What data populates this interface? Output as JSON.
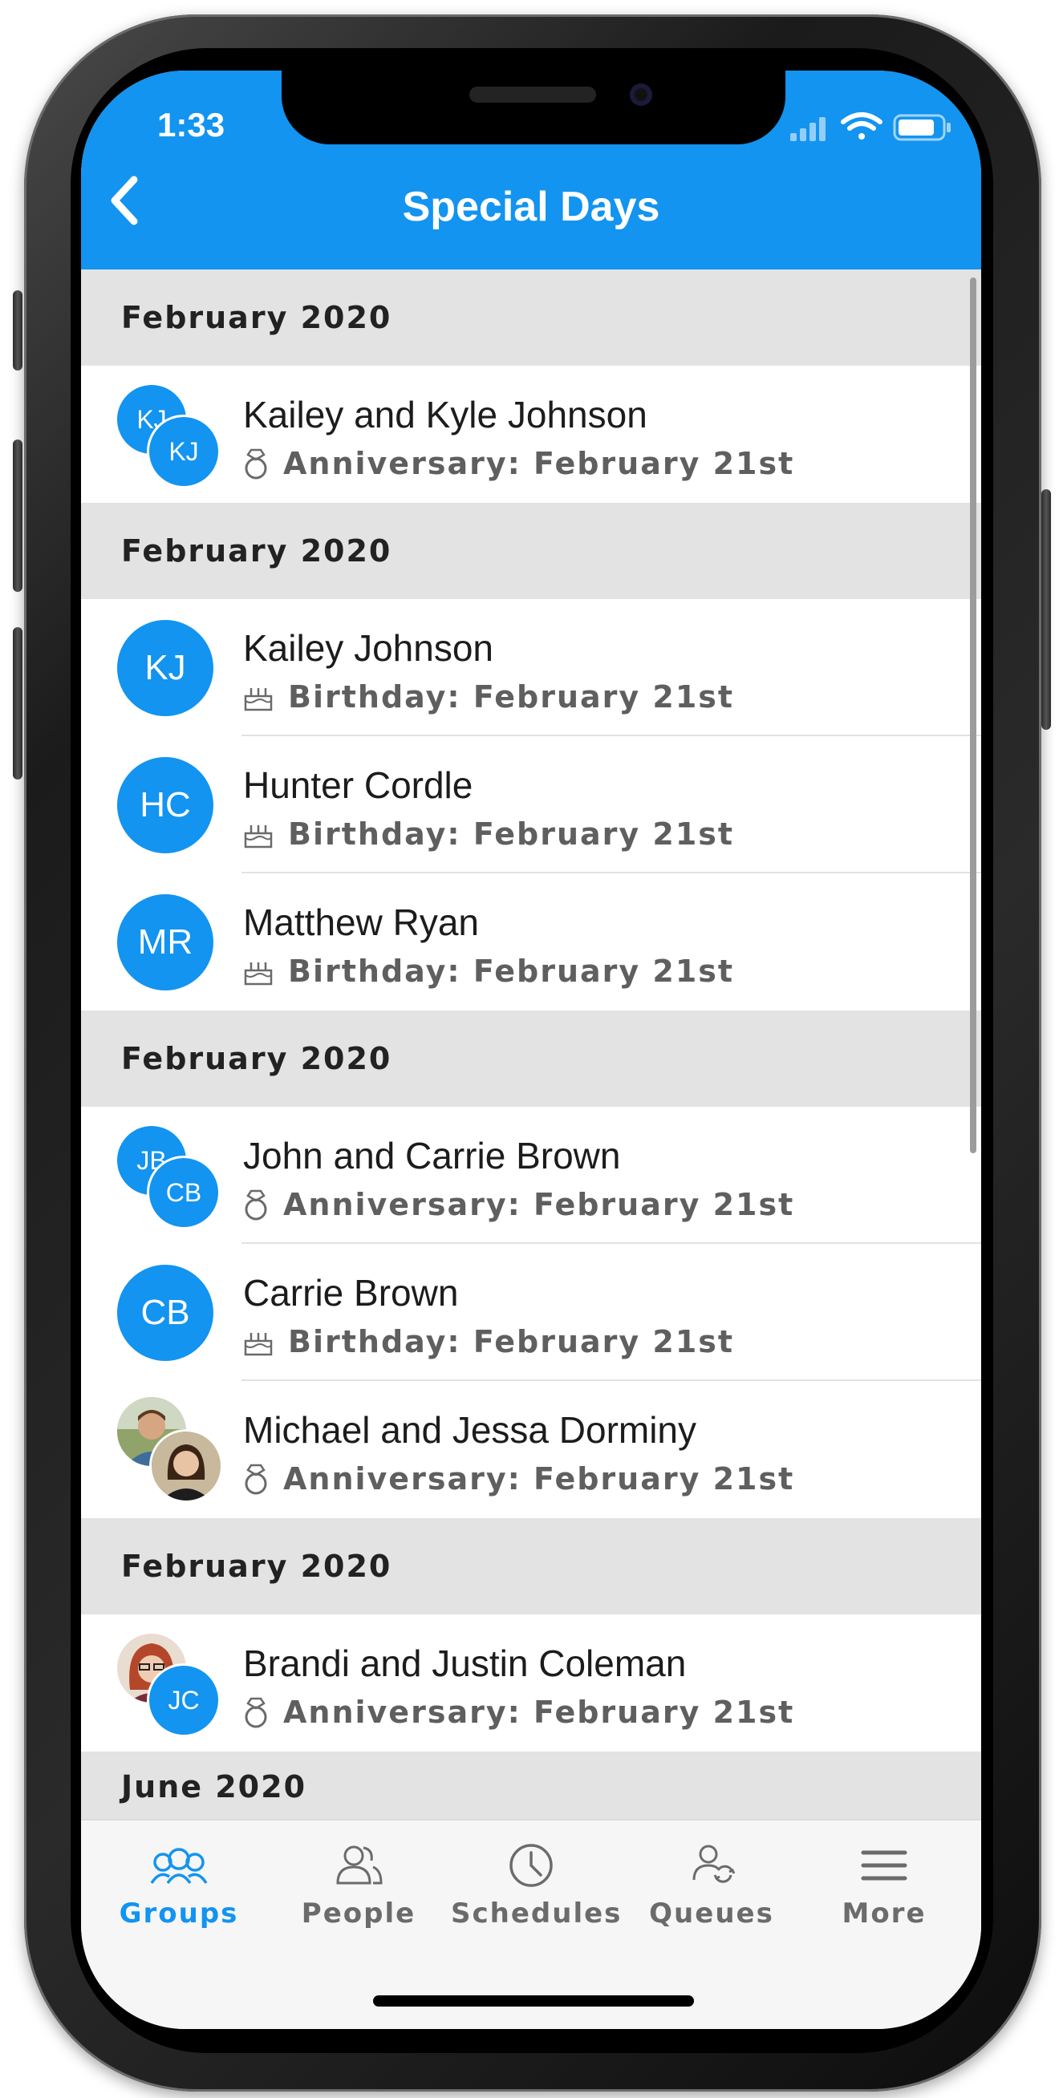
{
  "status_bar": {
    "time": "1:33"
  },
  "header": {
    "title": "Special Days"
  },
  "sections": [
    {
      "title": "February 2020",
      "items": [
        {
          "name": "Kailey and Kyle Johnson",
          "kind": "anniversary",
          "label": "Anniversary:",
          "date": "February 21st",
          "initials": [
            "KJ",
            "KJ"
          ]
        }
      ]
    },
    {
      "title": "February 2020",
      "items": [
        {
          "name": "Kailey Johnson",
          "kind": "birthday",
          "label": "Birthday:",
          "date": "February 21st",
          "initials": [
            "KJ"
          ]
        },
        {
          "name": "Hunter Cordle",
          "kind": "birthday",
          "label": "Birthday:",
          "date": "February 21st",
          "initials": [
            "HC"
          ]
        },
        {
          "name": "Matthew Ryan",
          "kind": "birthday",
          "label": "Birthday:",
          "date": "February 21st",
          "initials": [
            "MR"
          ]
        }
      ]
    },
    {
      "title": "February 2020",
      "items": [
        {
          "name": "John and Carrie Brown",
          "kind": "anniversary",
          "label": "Anniversary:",
          "date": "February 21st",
          "initials": [
            "JB",
            "CB"
          ]
        },
        {
          "name": "Carrie Brown",
          "kind": "birthday",
          "label": "Birthday:",
          "date": "February 21st",
          "initials": [
            "CB"
          ]
        },
        {
          "name": "Michael and Jessa Dorminy",
          "kind": "anniversary",
          "label": "Anniversary:",
          "date": "February 21st",
          "initials": [],
          "photos": 2
        }
      ]
    },
    {
      "title": "February 2020",
      "items": [
        {
          "name": "Brandi and Justin Coleman",
          "kind": "anniversary",
          "label": "Anniversary:",
          "date": "February 21st",
          "initials": [
            "JC"
          ],
          "photos": 1
        }
      ]
    },
    {
      "title": "June 2020",
      "items": []
    }
  ],
  "tabbar": {
    "tabs": [
      {
        "label": "Groups",
        "icon": "groups-icon",
        "active": true
      },
      {
        "label": "People",
        "icon": "people-icon",
        "active": false
      },
      {
        "label": "Schedules",
        "icon": "clock-icon",
        "active": false
      },
      {
        "label": "Queues",
        "icon": "queues-icon",
        "active": false
      },
      {
        "label": "More",
        "icon": "menu-icon",
        "active": false
      }
    ]
  },
  "colors": {
    "accent": "#1294f0",
    "section_bg": "#e3e3e3",
    "tab_inactive": "#6b6b6b"
  }
}
